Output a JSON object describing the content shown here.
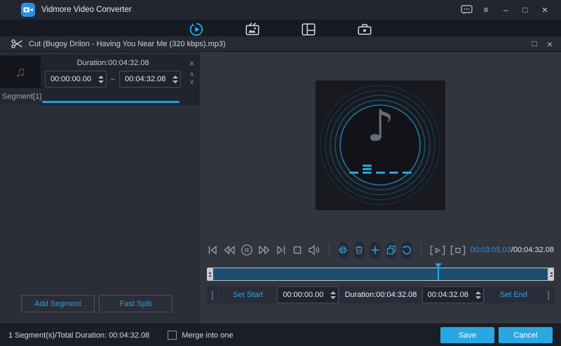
{
  "colors": {
    "accent": "#29a7e2",
    "timeline_fill": "#1d4e70",
    "panel_dark": "#20242e"
  },
  "titlebar": {
    "app_title": "Vidmore Video Converter"
  },
  "window_controls": {
    "menu_glyph": "≡",
    "minimize_glyph": "–",
    "maximize_glyph": "□",
    "close_glyph": "×"
  },
  "nav": {
    "icons": [
      "converter-icon",
      "mv-icon",
      "collage-icon",
      "toolbox-icon"
    ]
  },
  "dialog": {
    "title": "Cut (Bugoy Drilon - Having You Near Me (320 kbps).mp3)",
    "maximize_glyph": "□",
    "close_glyph": "×"
  },
  "segment_panel": {
    "note_glyph": "♫",
    "segment_label": "Segment[1]",
    "duration_label": "Duration:00:04:32.08",
    "start_value": "00:00:00.00",
    "range_separator": "–",
    "end_value": "00:04:32.08",
    "close_glyph": "×",
    "move_up_glyph": "∧",
    "move_down_glyph": "∨"
  },
  "left_actions": {
    "add_segment": "Add Segment",
    "fast_split": "Fast Split"
  },
  "player": {
    "note_glyph": "♪",
    "current_time": "00:03:05.03",
    "time_separator": "/",
    "total_time": "00:04:32.08",
    "progress_percent": 67.3
  },
  "trim_bar": {
    "bracket_left": "[",
    "set_start": "Set Start",
    "start_value": "00:00:00.00",
    "duration_label": "Duration:00:04:32.08",
    "end_value": "00:04:32.08",
    "set_end": "Set End",
    "bracket_right": "]"
  },
  "footer": {
    "summary": "1 Segment(s)/Total Duration: 00:04:32.08",
    "merge_label": "Merge into one",
    "merge_checked": false,
    "save": "Save",
    "cancel": "Cancel"
  }
}
